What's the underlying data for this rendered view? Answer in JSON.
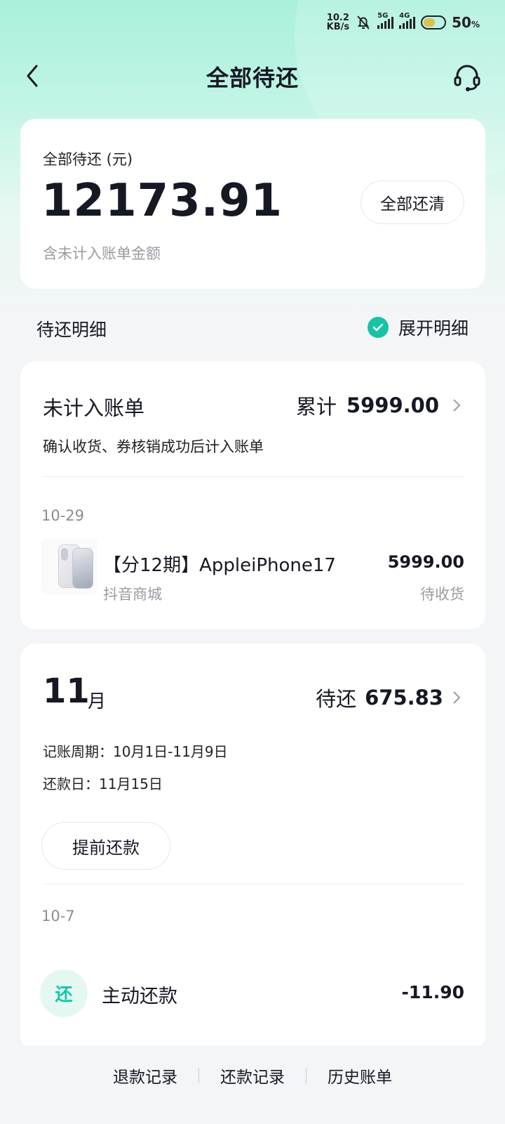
{
  "status_bar": {
    "net_speed_value": "10.2",
    "net_speed_unit": "KB/s",
    "sim1_tag": "5G",
    "sim2_tag": "4G",
    "battery_percent": "50",
    "battery_unit": "%"
  },
  "header": {
    "title": "全部待还"
  },
  "summary": {
    "label": "全部待还 (元)",
    "amount": "12173.91",
    "note": "含未计入账单金额",
    "payoff_label": "全部还清"
  },
  "details": {
    "title": "待还明细",
    "expand_label": "展开明细"
  },
  "unbilled": {
    "title": "未计入账单",
    "total_prefix": "累计",
    "total_value": "5999.00",
    "description": "确认收货、券核销成功后计入账单",
    "date": "10-29",
    "item": {
      "name": "【分12期】AppleiPhone17",
      "shop": "抖音商城",
      "price": "5999.00",
      "status": "待收货"
    }
  },
  "month": {
    "number": "11",
    "unit": "月",
    "due_prefix": "待还",
    "due_value": "675.83",
    "cycle": "记账周期：10月1日-11月9日",
    "due_day": "还款日：11月15日",
    "prepay_label": "提前还款",
    "record_date": "10-7",
    "record_icon": "还",
    "record_name": "主动还款",
    "record_amount": "-11.90"
  },
  "bottom_links": [
    "退款记录",
    "还款记录",
    "历史账单"
  ],
  "colors": {
    "accent": "#17c3a5",
    "header_bg": "#a8f0dc"
  }
}
